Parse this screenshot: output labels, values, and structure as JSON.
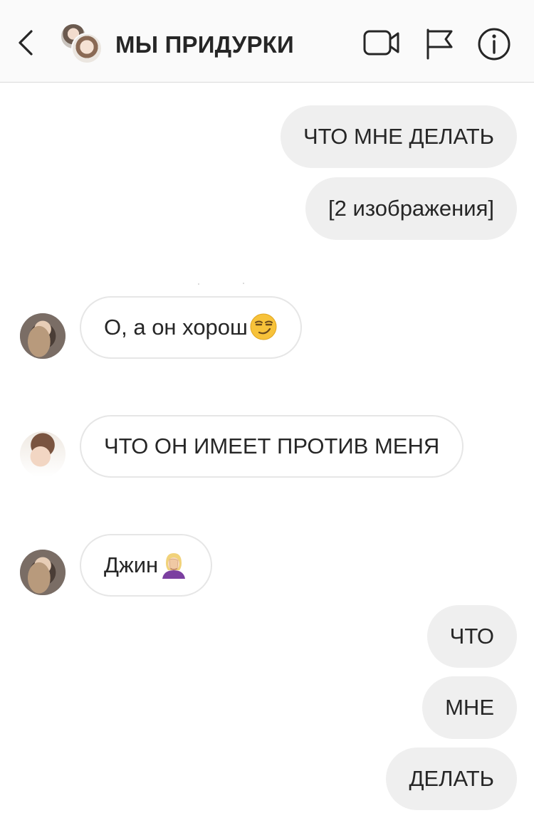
{
  "header": {
    "title": "МЫ ПРИДУРКИ",
    "back_icon": "chevron-left-icon",
    "actions": [
      "video-camera-icon",
      "flag-icon",
      "info-icon"
    ]
  },
  "messages": [
    {
      "direction": "outgoing",
      "text": "ЧТО МНЕ ДЕЛАТЬ"
    },
    {
      "direction": "outgoing",
      "text": "[2 изображения]"
    },
    {
      "direction": "incoming",
      "text": "О, а он хорош",
      "emoji": "smirking-face-emoji",
      "avatar": "dark"
    },
    {
      "direction": "incoming",
      "text": "ЧТО ОН ИМЕЕТ ПРОТИВ МЕНЯ",
      "avatar": "light"
    },
    {
      "direction": "incoming",
      "text": "Джин",
      "emoji": "face-palm-woman-emoji",
      "avatar": "dark"
    },
    {
      "direction": "outgoing",
      "text": "ЧТО"
    },
    {
      "direction": "outgoing",
      "text": "МНЕ"
    },
    {
      "direction": "outgoing",
      "text": "ДЕЛАТЬ"
    }
  ],
  "colors": {
    "header_bg": "#fafafa",
    "outgoing_bubble": "#efefef",
    "incoming_border": "#e6e6e6",
    "text": "#262626"
  }
}
